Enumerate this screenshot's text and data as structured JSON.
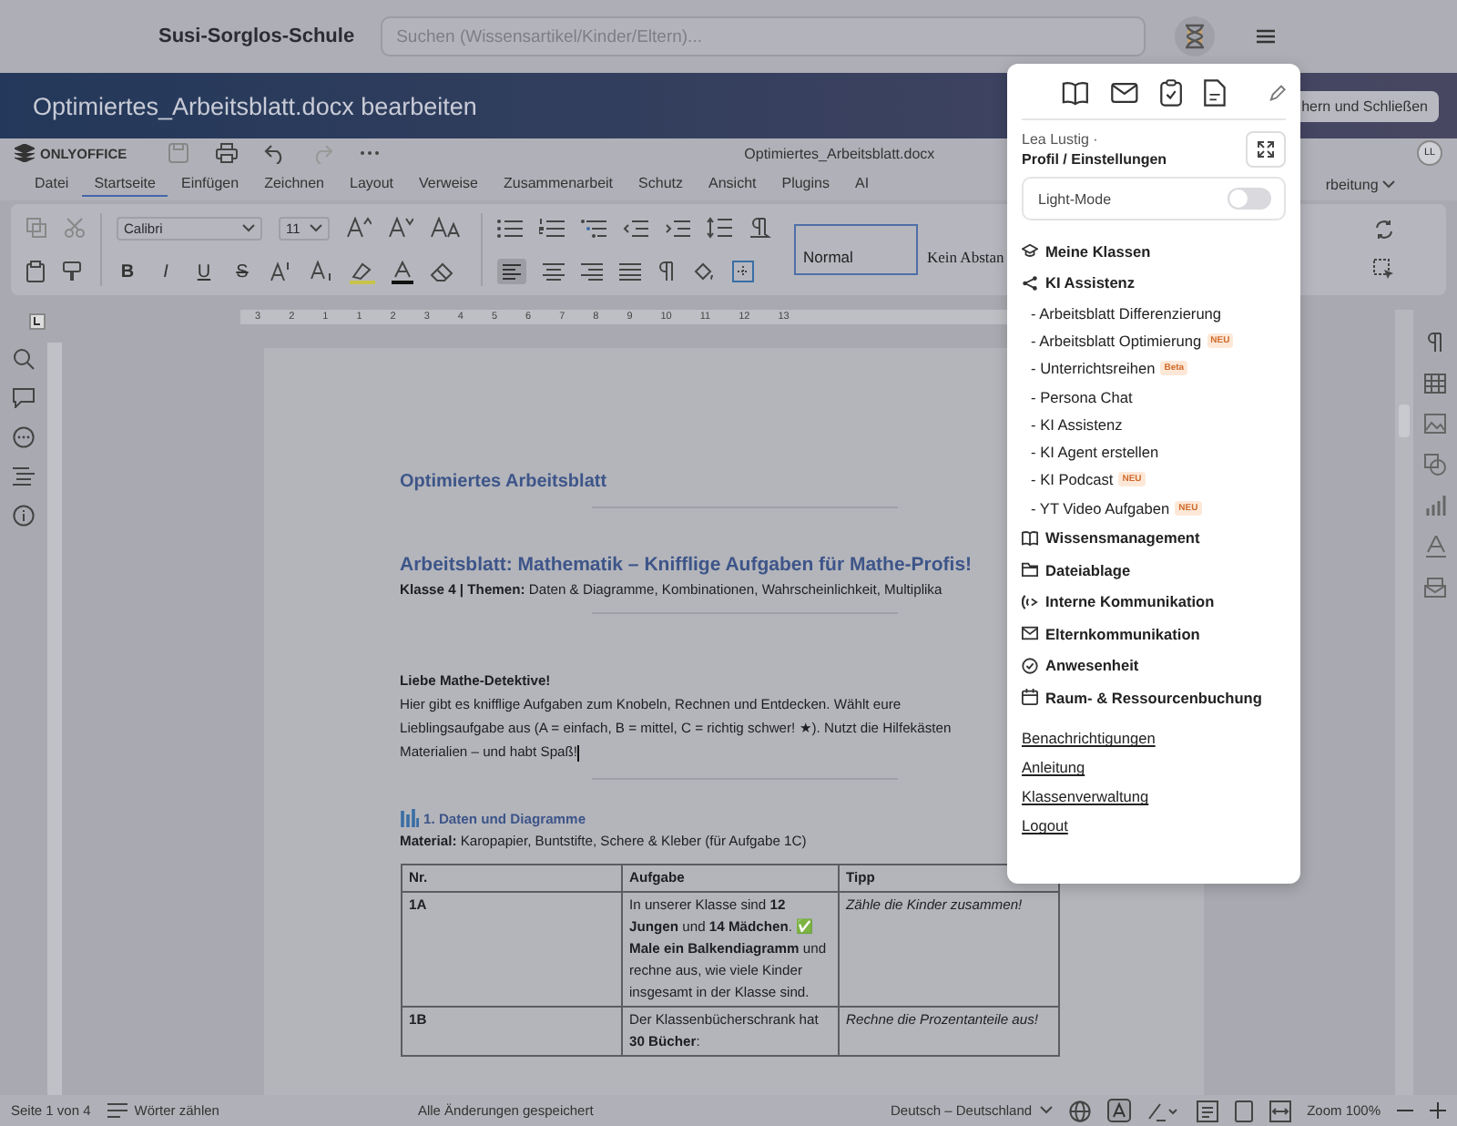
{
  "top_bar": {
    "school_name": "Susi-Sorglos-Schule",
    "search": {
      "placeholder": "Suchen (Wissensartikel/Kinder/Eltern)..."
    }
  },
  "banner": {
    "title": "Optimiertes_Arbeitsblatt.docx bearbeiten",
    "button": "hern und Schließen"
  },
  "editor": {
    "logo": "ONLYOFFICE",
    "filename": "Optimiertes_Arbeitsblatt.docx",
    "avatar": "LL",
    "menu_tabs": [
      {
        "label": "Datei",
        "selected": false
      },
      {
        "label": "Startseite",
        "selected": true
      },
      {
        "label": "Einfügen",
        "selected": false
      },
      {
        "label": "Zeichnen",
        "selected": false
      },
      {
        "label": "Layout",
        "selected": false
      },
      {
        "label": "Verweise",
        "selected": false
      },
      {
        "label": "Zusammenarbeit",
        "selected": false
      },
      {
        "label": "Schutz",
        "selected": false
      },
      {
        "label": "Ansicht",
        "selected": false
      },
      {
        "label": "Plugins",
        "selected": false
      },
      {
        "label": "AI",
        "selected": false
      }
    ],
    "mode_dropdown": "rbeitung",
    "toolbar": {
      "font": "Calibri",
      "size": "11",
      "format_buttons": [
        "B",
        "I",
        "U",
        "S"
      ],
      "styles": [
        {
          "label": "Normal",
          "selected": true
        },
        {
          "label": "Kein Abstan",
          "selected": false
        }
      ]
    },
    "ruler": [
      "3",
      "2",
      "1",
      "1",
      "2",
      "3",
      "4",
      "5",
      "6",
      "7",
      "8",
      "9",
      "10",
      "11",
      "12",
      "13"
    ],
    "document": {
      "title": "Optimiertes Arbeitsblatt",
      "heading": "Arbeitsblatt: Mathematik – Knifflige Aufgaben für Mathe-Profis!",
      "subline": "**Klasse 4 | Themen:** Daten & Diagramme, Kombinationen, Wahrscheinlichkeit, Multiplika",
      "greeting": "Liebe Mathe-Detektive!",
      "intro_lines": [
        "Hier gibt es knifflige Aufgaben zum Knobeln, Rechnen und Entdecken. Wählt eure",
        "Lieblingsaufgabe aus (A = einfach, B = mittel, C = richtig schwer! ★). Nutzt die Hilfekästen",
        "Materialien – und habt Spaß!"
      ],
      "section_heading": "1. Daten und Diagramme",
      "material": "**Material:** Karopapier, Buntstifte, Schere & Kleber (für Aufgabe 1C)",
      "table": {
        "columns": [
          "Nr.",
          "Aufgabe",
          "Tipp"
        ],
        "rows": [
          [
            "1A",
            "In unserer Klasse sind **12 Jungen** und **14 Mädchen**. ✅ **Male ein Balkendiagramm** und rechne aus, wie viele Kinder insgesamt in der Klasse sind.",
            "Zähle die Kinder zusammen!"
          ],
          [
            "1B",
            "Der Klassenbücherschrank hat **30 Bücher**:",
            "Rechne die Prozentanteile aus!"
          ]
        ]
      }
    },
    "status_bar": {
      "page": "Seite 1 von 4",
      "word_count": "Wörter zählen",
      "saved": "Alle Änderungen gespeichert",
      "language": "Deutsch – Deutschland",
      "zoom": "Zoom 100%"
    }
  },
  "menu": {
    "user": "Lea Lustig ·",
    "profile": "Profil / Einstellungen",
    "light_mode": {
      "label": "Light-Mode",
      "on": false
    },
    "items": [
      {
        "kind": "section",
        "label": "Meine Klassen"
      },
      {
        "kind": "section",
        "label": "KI Assistenz"
      },
      {
        "kind": "sub",
        "label": "- Arbeitsblatt Differenzierung"
      },
      {
        "kind": "sub",
        "label": "- Arbeitsblatt Optimierung",
        "badge": "NEU"
      },
      {
        "kind": "sub",
        "label": "- Unterrichtsreihen",
        "badge": "Beta"
      },
      {
        "kind": "sub",
        "label": "- Persona Chat"
      },
      {
        "kind": "sub",
        "label": "- KI Assistenz"
      },
      {
        "kind": "sub",
        "label": "- KI Agent erstellen"
      },
      {
        "kind": "sub",
        "label": "- KI Podcast",
        "badge": "NEU"
      },
      {
        "kind": "sub",
        "label": "- YT Video Aufgaben",
        "badge": "NEU"
      },
      {
        "kind": "section",
        "label": "Wissensmanagement"
      },
      {
        "kind": "section",
        "label": "Dateiablage"
      },
      {
        "kind": "section",
        "label": "Interne Kommunikation"
      },
      {
        "kind": "section",
        "label": "Elternkommunikation"
      },
      {
        "kind": "section",
        "label": "Anwesenheit"
      },
      {
        "kind": "section",
        "label": "Raum- & Ressourcenbuchung"
      }
    ],
    "links": [
      "Benachrichtigungen",
      "Anleitung",
      "Klassenverwaltung",
      "Logout"
    ]
  }
}
